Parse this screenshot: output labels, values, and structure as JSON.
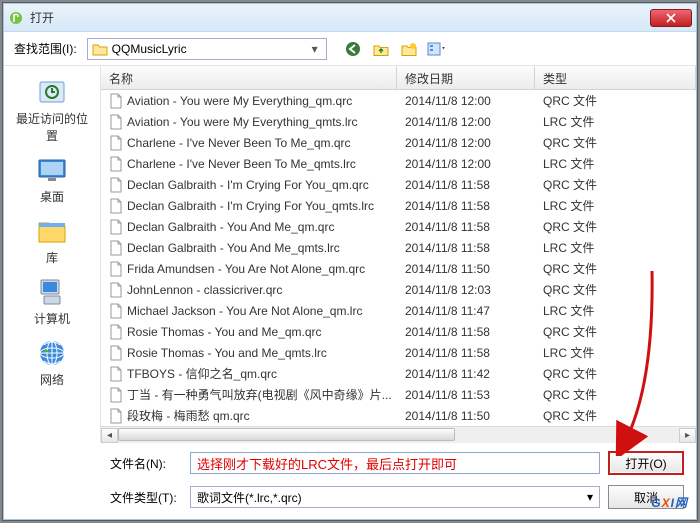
{
  "title": "打开",
  "lookin_label": "查找范围(I):",
  "lookin_value": "QQMusicLyric",
  "sidebar": [
    {
      "label": "最近访问的位置"
    },
    {
      "label": "桌面"
    },
    {
      "label": "库"
    },
    {
      "label": "计算机"
    },
    {
      "label": "网络"
    }
  ],
  "columns": {
    "name": "名称",
    "date": "修改日期",
    "type": "类型"
  },
  "files": [
    {
      "name": "Aviation - You were My Everything_qm.qrc",
      "date": "2014/11/8 12:00",
      "type": "QRC 文件"
    },
    {
      "name": "Aviation - You were My Everything_qmts.lrc",
      "date": "2014/11/8 12:00",
      "type": "LRC 文件"
    },
    {
      "name": "Charlene - I've Never Been To Me_qm.qrc",
      "date": "2014/11/8 12:00",
      "type": "QRC 文件"
    },
    {
      "name": "Charlene - I've Never Been To Me_qmts.lrc",
      "date": "2014/11/8 12:00",
      "type": "LRC 文件"
    },
    {
      "name": "Declan Galbraith - I'm Crying For You_qm.qrc",
      "date": "2014/11/8 11:58",
      "type": "QRC 文件"
    },
    {
      "name": "Declan Galbraith - I'm Crying For You_qmts.lrc",
      "date": "2014/11/8 11:58",
      "type": "LRC 文件"
    },
    {
      "name": "Declan Galbraith - You And Me_qm.qrc",
      "date": "2014/11/8 11:58",
      "type": "QRC 文件"
    },
    {
      "name": "Declan Galbraith - You And Me_qmts.lrc",
      "date": "2014/11/8 11:58",
      "type": "LRC 文件"
    },
    {
      "name": "Frida Amundsen - You Are Not Alone_qm.qrc",
      "date": "2014/11/8 11:50",
      "type": "QRC 文件"
    },
    {
      "name": "JohnLennon - classicriver.qrc",
      "date": "2014/11/8 12:03",
      "type": "QRC 文件"
    },
    {
      "name": "Michael Jackson - You Are Not Alone_qm.lrc",
      "date": "2014/11/8 11:47",
      "type": "LRC 文件"
    },
    {
      "name": "Rosie Thomas - You and Me_qm.qrc",
      "date": "2014/11/8 11:58",
      "type": "QRC 文件"
    },
    {
      "name": "Rosie Thomas - You and Me_qmts.lrc",
      "date": "2014/11/8 11:58",
      "type": "LRC 文件"
    },
    {
      "name": "TFBOYS - 信仰之名_qm.qrc",
      "date": "2014/11/8 11:42",
      "type": "QRC 文件"
    },
    {
      "name": "丁当 - 有一种勇气叫放弃(电视剧《风中奇缘》片...",
      "date": "2014/11/8 11:53",
      "type": "QRC 文件"
    },
    {
      "name": "段玫梅 - 梅雨愁 qm.qrc",
      "date": "2014/11/8 11:50",
      "type": "QRC 文件"
    }
  ],
  "filename_label": "文件名(N):",
  "filename_value": "",
  "hint_text": "选择刚才下载好的LRC文件，最后点打开即可",
  "filetype_label": "文件类型(T):",
  "filetype_value": "歌词文件(*.lrc,*.qrc)",
  "open_button": "打开(O)",
  "cancel_button": "取消",
  "watermark": {
    "g": "G",
    "x": "X",
    "i": "I网"
  }
}
